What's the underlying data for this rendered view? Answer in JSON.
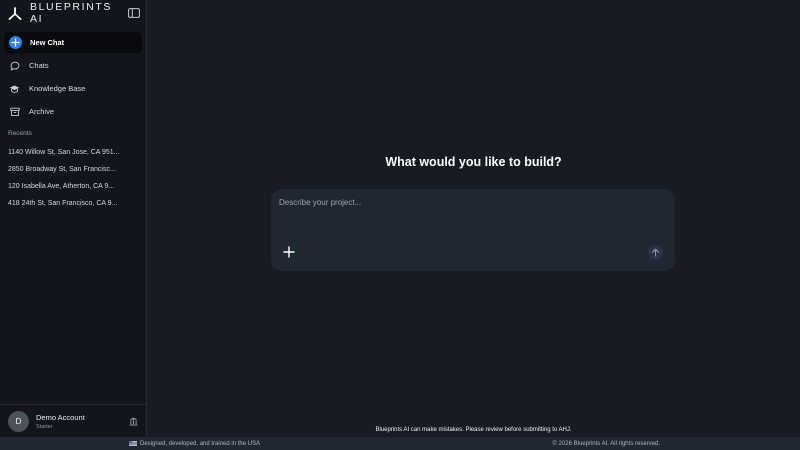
{
  "brand": {
    "name": "BLUEPRINTS AI"
  },
  "nav": {
    "items": [
      {
        "label": "New Chat",
        "icon": "plus-circle-icon",
        "active": true
      },
      {
        "label": "Chats",
        "icon": "chat-bubble-icon"
      },
      {
        "label": "Knowledge Base",
        "icon": "graduation-cap-icon"
      },
      {
        "label": "Archive",
        "icon": "archive-box-icon"
      }
    ]
  },
  "recents": {
    "label": "Recents",
    "items": [
      "1140 Willow St, San Jose, CA 951...",
      "2850 Broadway St, San Francisc...",
      "120 Isabella Ave, Atherton, CA 9...",
      "418 24th St, San Francisco, CA 9..."
    ]
  },
  "account": {
    "initial": "D",
    "name": "Demo Account",
    "plan": "Starter"
  },
  "main": {
    "heading": "What would you like to build?",
    "composer": {
      "placeholder": "Describe your project...",
      "value": ""
    }
  },
  "disclaimer": "Blueprints AI can make mistakes. Please review before submitting to AHJ.",
  "footer": {
    "left": "Designed, developed, and trained in the USA",
    "right": "© 2026 Blueprints AI. All rights reserved."
  },
  "colors": {
    "accent": "#2f7fe6",
    "background": "#171c24",
    "sidebar": "#12161c",
    "composer": "#1f2733"
  }
}
